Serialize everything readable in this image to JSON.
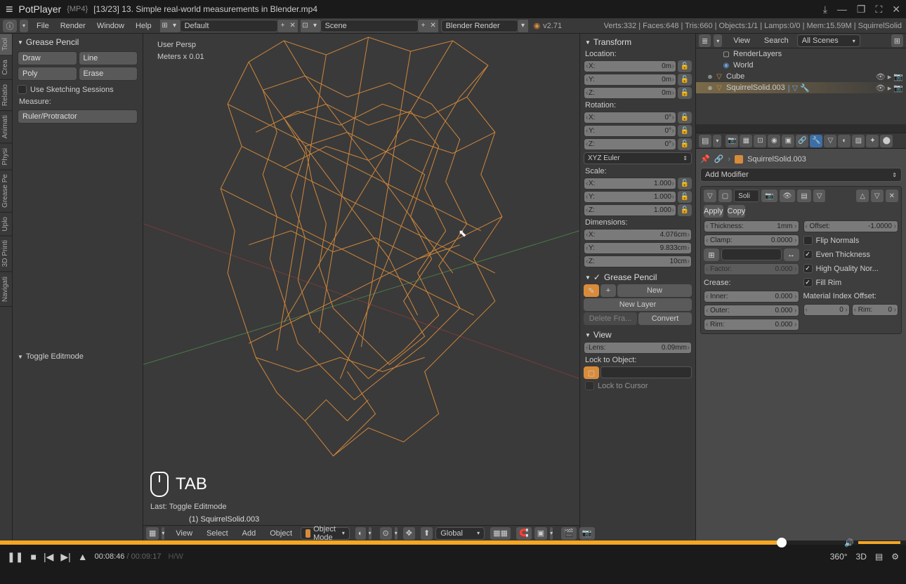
{
  "titlebar": {
    "app": "PotPlayer",
    "format": "{MP4}",
    "title": "[13/23] 13. Simple real-world measurements in Blender.mp4"
  },
  "blender_menu": {
    "file": "File",
    "render": "Render",
    "window": "Window",
    "help": "Help"
  },
  "layout": "Default",
  "scene": "Scene",
  "engine": "Blender Render",
  "version": "v2.71",
  "stats": "Verts:332 | Faces:648 | Tris:660 | Objects:1/1 | Lamps:0/0 | Mem:15.59M | SquirrelSolid",
  "vtabs": [
    "Tool",
    "Crea",
    "Relatio",
    "Animati",
    "Physi",
    "Grease Pe",
    "Uplo",
    "3D Printi",
    "Navigati"
  ],
  "grease": {
    "title": "Grease Pencil",
    "draw": "Draw",
    "line": "Line",
    "poly": "Poly",
    "erase": "Erase",
    "sketch": "Use Sketching Sessions",
    "measure": "Measure:",
    "ruler": "Ruler/Protractor"
  },
  "toggle_edit": "Toggle Editmode",
  "viewport": {
    "persp": "User Persp",
    "units": "Meters x 0.01",
    "tab_hint": "TAB",
    "last": "Last: Toggle Editmode",
    "obj": "(1) SquirrelSolid.003"
  },
  "vp_header": {
    "view": "View",
    "select": "Select",
    "add": "Add",
    "object": "Object",
    "mode": "Object Mode",
    "orient": "Global"
  },
  "npanel": {
    "transform": "Transform",
    "loc": "Location:",
    "rot": "Rotation:",
    "scale": "Scale:",
    "euler": "XYZ Euler",
    "dims": "Dimensions:",
    "location": {
      "x": "0m",
      "y": "0m",
      "z": "0m"
    },
    "rotation": {
      "x": "0°",
      "y": "0°",
      "z": "0°"
    },
    "scale_v": {
      "x": "1.000",
      "y": "1.000",
      "z": "1.000"
    },
    "dims_v": {
      "x": "4.076cm",
      "y": "9.833cm",
      "z": "10cm"
    },
    "gp": "Grease Pencil",
    "new": "New",
    "new_layer": "New Layer",
    "del": "Delete Fra...",
    "conv": "Convert",
    "view": "View",
    "lens_l": "Lens:",
    "lens_v": "0.09mm",
    "lockobj": "Lock to Object:",
    "lockcur": "Lock to Cursor"
  },
  "outliner": {
    "view": "View",
    "search": "Search",
    "all": "All Scenes",
    "items": [
      {
        "name": "RenderLayers",
        "indent": 2,
        "icon": "▢"
      },
      {
        "name": "World",
        "indent": 2,
        "icon": "◉"
      },
      {
        "name": "Cube",
        "indent": 2,
        "icon": "▽",
        "toggle": "⊕"
      },
      {
        "name": "SquirrelSolid.003",
        "indent": 2,
        "icon": "▽",
        "sel": true,
        "toggle": "⊕"
      }
    ]
  },
  "props": {
    "obj": "SquirrelSolid.003",
    "add_mod": "Add Modifier",
    "mod_name": "Soli",
    "apply": "Apply",
    "copy": "Copy",
    "thick_l": "Thickness:",
    "thick_v": "1mm",
    "offset_l": "Offset:",
    "offset_v": "-1.0000",
    "clamp_l": "Clamp:",
    "clamp_v": "0.0000",
    "flip": "Flip Normals",
    "even": "Even Thickness",
    "hq": "High Quality Nor...",
    "fill": "Fill Rim",
    "factor_l": "Factor:",
    "factor_v": "0.000",
    "crease": "Crease:",
    "mat_idx": "Material Index Offset:",
    "inner_l": "Inner:",
    "inner_v": "0.000",
    "outer_l": "Outer:",
    "outer_v": "0.000",
    "rim_l": "Rim:",
    "rim_v": "0.000",
    "mat0_v": "0",
    "matrim_l": "Rim:",
    "matrim_v": "0"
  },
  "player": {
    "cur": "00:08:46",
    "dur": "00:09:17",
    "hw": "H/W",
    "progress_pct": 94.3,
    "r1": "360°",
    "r2": "3D"
  }
}
